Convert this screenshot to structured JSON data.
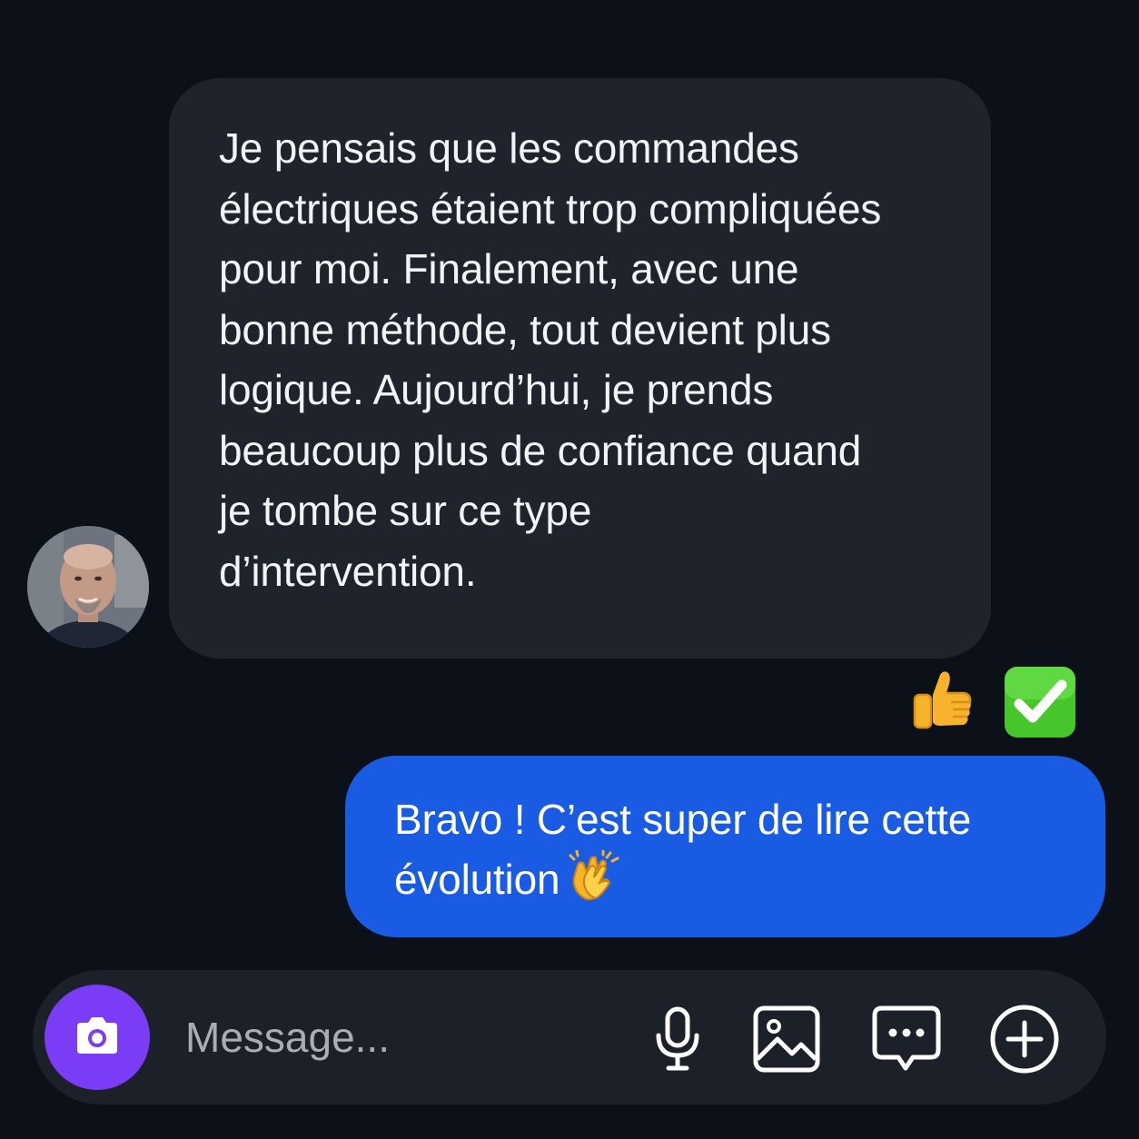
{
  "conversation": {
    "incoming": {
      "text": "Je pensais que les commandes\nélectriques étaient trop compliquées\npour moi. Finalement, avec une\nbonne méthode, tout devient plus\nlogique. Aujourd’hui, je prends\nbeaucoup plus de confiance quand\nje tombe sur ce type\nd’intervention.",
      "avatar_icon": "person-photo-avatar",
      "reactions": [
        {
          "icon": "thumbs-up-emoji"
        },
        {
          "icon": "check-mark-emoji"
        }
      ]
    },
    "outgoing": {
      "text": "Bravo ! C’est super de lire cette évolution",
      "emoji_icon": "clapping-hands-emoji"
    }
  },
  "composer": {
    "placeholder": "Message...",
    "camera_icon": "camera-icon",
    "tools": [
      {
        "icon": "microphone-icon"
      },
      {
        "icon": "image-icon"
      },
      {
        "icon": "chat-dots-icon"
      },
      {
        "icon": "plus-circle-icon"
      }
    ]
  },
  "colors": {
    "background": "#0c1119",
    "incoming_bubble": "#1f232b",
    "outgoing_bubble": "#1a5be3",
    "camera_button": "#7a3cf5",
    "composer_bar": "#1c2028"
  }
}
